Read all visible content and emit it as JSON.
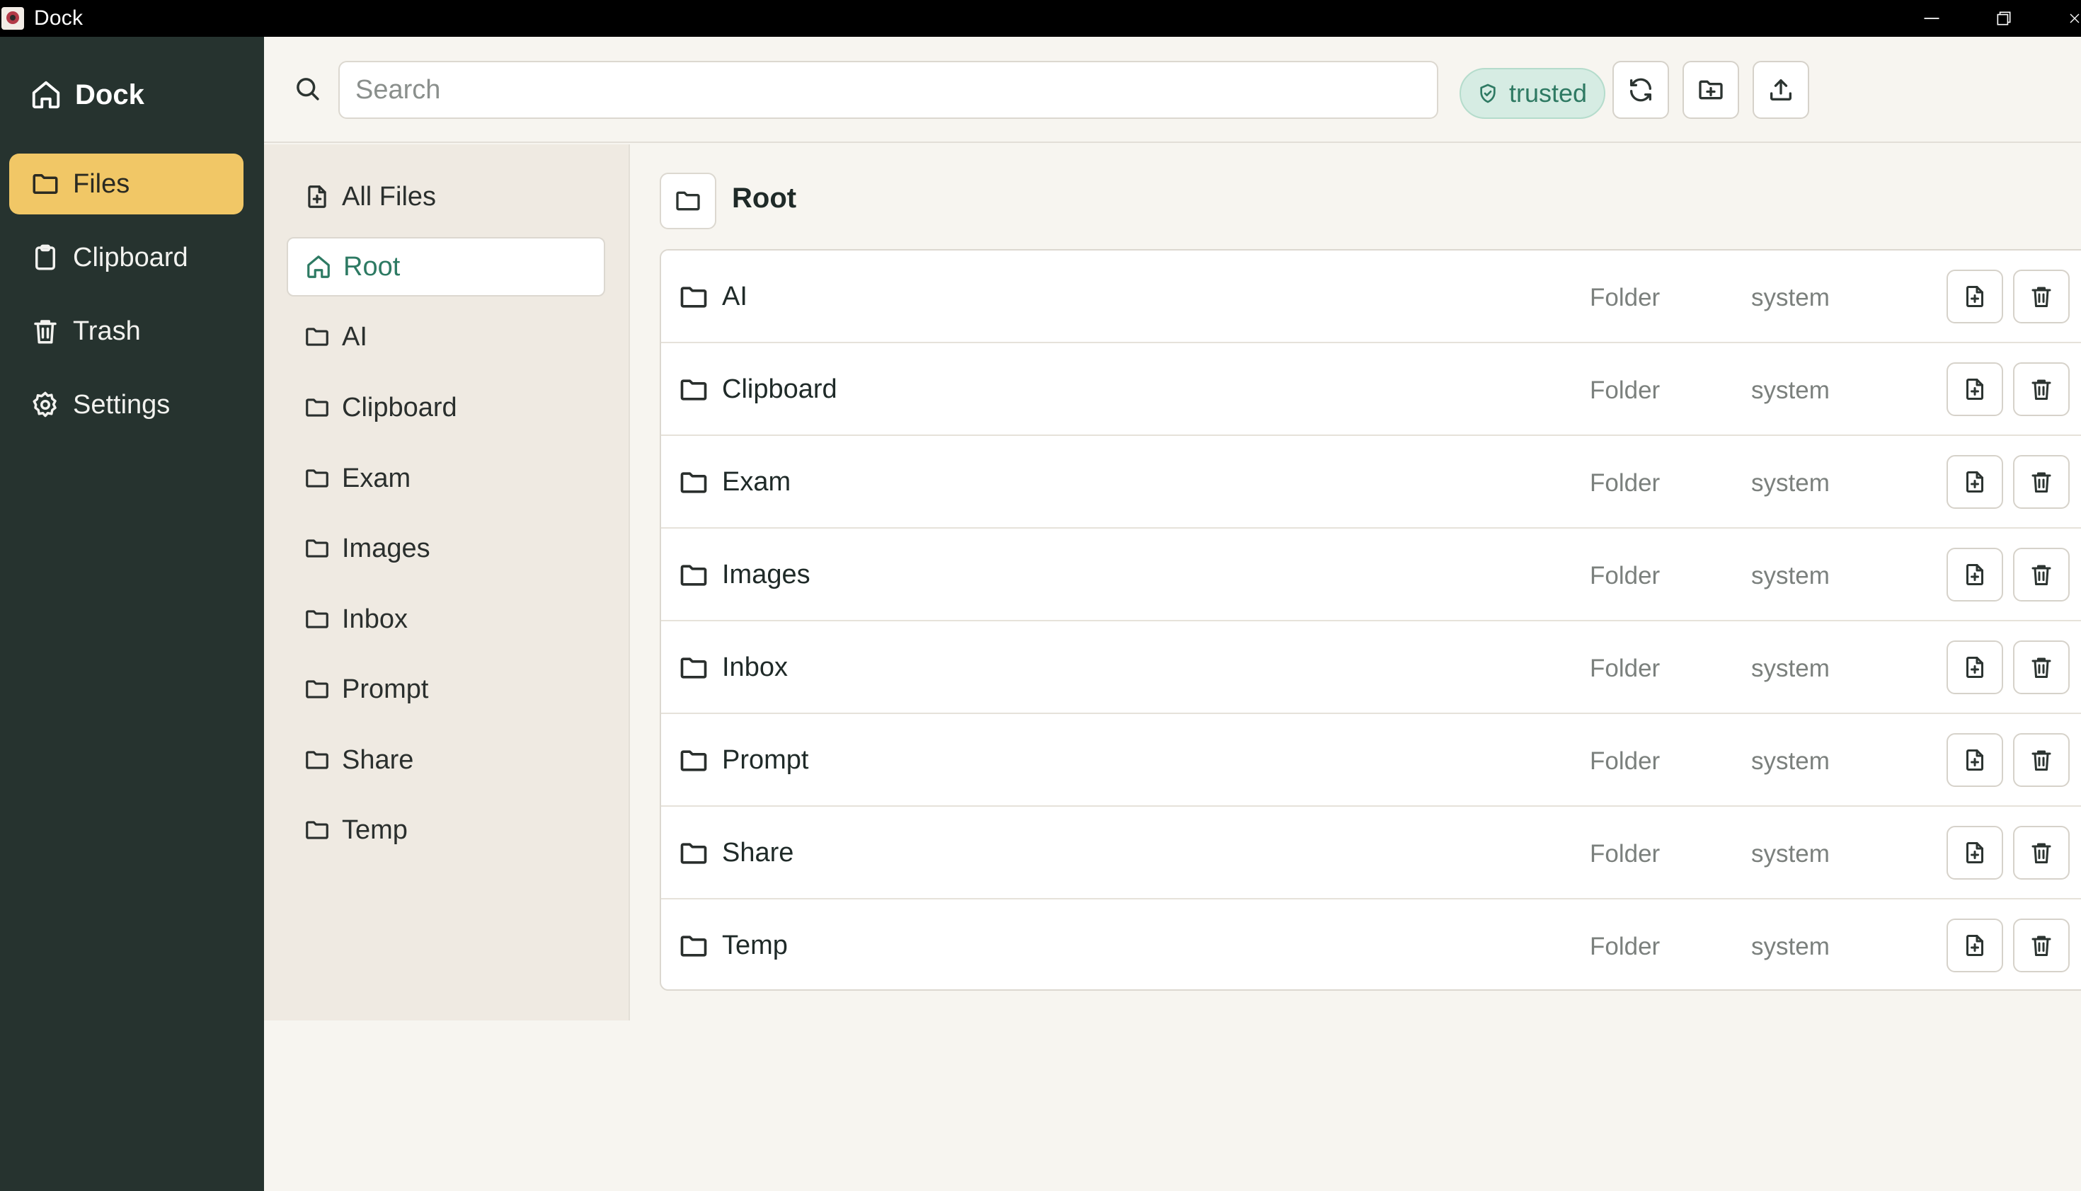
{
  "window": {
    "title": "Dock"
  },
  "nav": {
    "brand": "Dock",
    "items": [
      {
        "label": "Files",
        "icon": "folder-icon",
        "active": true
      },
      {
        "label": "Clipboard",
        "icon": "clipboard-icon",
        "active": false
      },
      {
        "label": "Trash",
        "icon": "trash-icon",
        "active": false
      },
      {
        "label": "Settings",
        "icon": "gear-icon",
        "active": false
      }
    ]
  },
  "header": {
    "search_placeholder": "Search",
    "search_value": "",
    "badge": "trusted",
    "actions": [
      "refresh",
      "new-folder",
      "upload"
    ]
  },
  "tree": {
    "items": [
      {
        "label": "All Files",
        "icon": "file-plus-icon"
      },
      {
        "label": "Root",
        "icon": "home-icon",
        "active": true
      },
      {
        "label": "AI",
        "icon": "folder-icon"
      },
      {
        "label": "Clipboard",
        "icon": "folder-icon"
      },
      {
        "label": "Exam",
        "icon": "folder-icon"
      },
      {
        "label": "Images",
        "icon": "folder-icon"
      },
      {
        "label": "Inbox",
        "icon": "folder-icon"
      },
      {
        "label": "Prompt",
        "icon": "folder-icon"
      },
      {
        "label": "Share",
        "icon": "folder-icon"
      },
      {
        "label": "Temp",
        "icon": "folder-icon"
      }
    ]
  },
  "main": {
    "title": "Root",
    "rows": [
      {
        "name": "AI",
        "type": "Folder",
        "owner": "system"
      },
      {
        "name": "Clipboard",
        "type": "Folder",
        "owner": "system"
      },
      {
        "name": "Exam",
        "type": "Folder",
        "owner": "system"
      },
      {
        "name": "Images",
        "type": "Folder",
        "owner": "system"
      },
      {
        "name": "Inbox",
        "type": "Folder",
        "owner": "system"
      },
      {
        "name": "Prompt",
        "type": "Folder",
        "owner": "system"
      },
      {
        "name": "Share",
        "type": "Folder",
        "owner": "system"
      },
      {
        "name": "Temp",
        "type": "Folder",
        "owner": "system"
      }
    ]
  },
  "colors": {
    "sidebar_bg": "#26332f",
    "active_nav": "#f1c766",
    "accent_green": "#2d7a63",
    "badge_bg": "#d6ece3"
  }
}
